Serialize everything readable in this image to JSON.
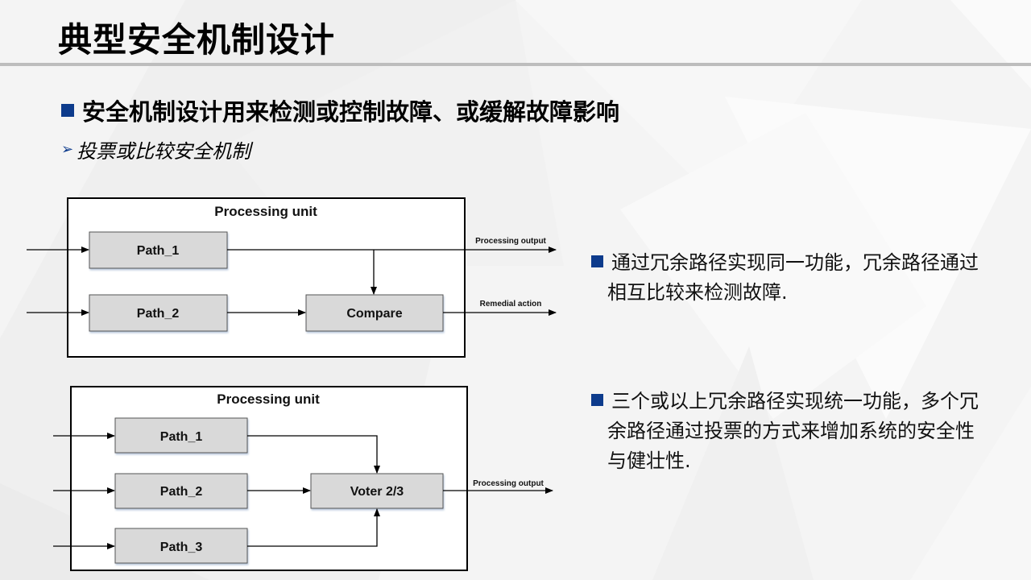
{
  "slide": {
    "title": "典型安全机制设计",
    "heading": "安全机制设计用来检测或控制故障、或缓解故障影响",
    "subheading": "投票或比较安全机制",
    "colors": {
      "accent": "#0d3b8c",
      "box_fill": "#d9d9d9",
      "rule": "#bdbdbd"
    }
  },
  "diagram1": {
    "unit_label": "Processing unit",
    "path1": "Path_1",
    "path2": "Path_2",
    "compare": "Compare",
    "output_label": "Processing output",
    "remedial_label": "Remedial action"
  },
  "diagram2": {
    "unit_label": "Processing unit",
    "path1": "Path_1",
    "path2": "Path_2",
    "path3": "Path_3",
    "voter": "Voter 2/3",
    "output_label": "Processing output"
  },
  "bullets": [
    {
      "line1": "通过冗余路径实现同一功能，冗余路径通过",
      "line2": "相互比较来检测故障."
    },
    {
      "line1": "三个或以上冗余路径实现统一功能，多个冗",
      "line2": "余路径通过投票的方式来增加系统的安全性",
      "line3": "与健壮性."
    }
  ]
}
